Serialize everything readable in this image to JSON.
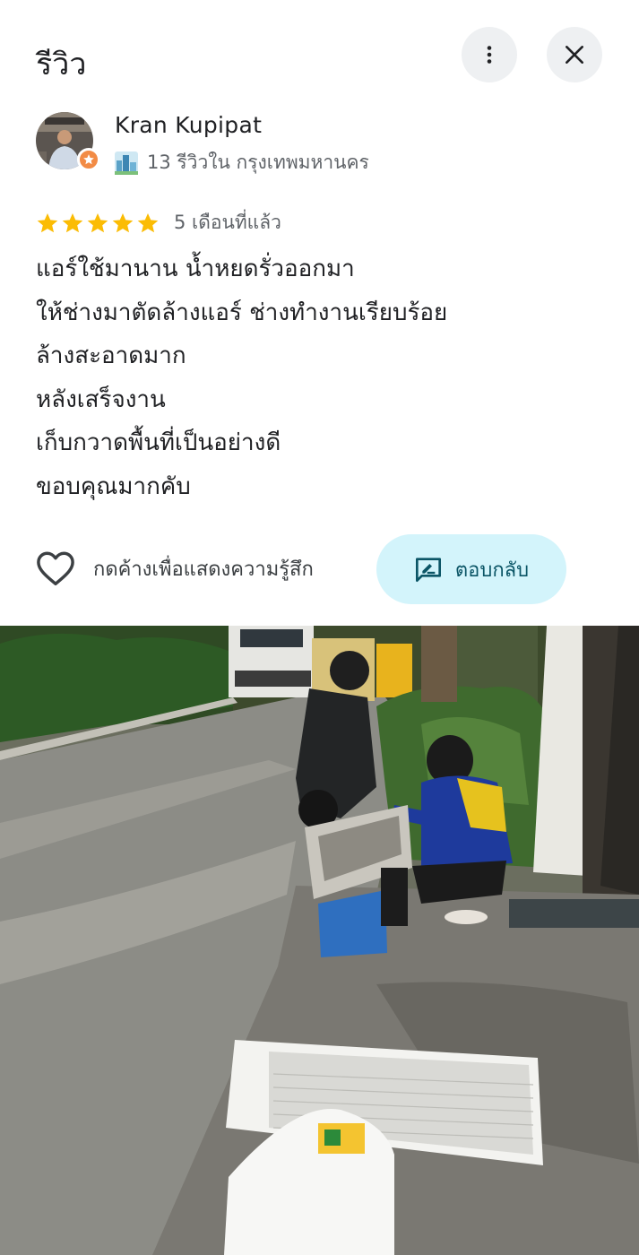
{
  "header": {
    "title": "รีวิว",
    "more_icon": "more-vert-icon",
    "close_icon": "close-icon"
  },
  "author": {
    "name": "Kran Kupipat",
    "meta": "13 รีวิวใน กรุงเทพมหานคร",
    "meta_icon": "city-icon",
    "badge_icon": "local-guide-star-icon"
  },
  "review": {
    "stars": 5,
    "max_stars": 5,
    "time_ago": "5 เดือนที่แล้ว",
    "lines": [
      "แอร์ใช้มานาน น้ำหยดรั่วออกมา",
      "ให้ช่างมาตัดล้างแอร์ ช่างทำงานเรียบร้อย",
      "ล้างสะอาดมาก",
      "หลังเสร็จงาน",
      "เก็บกวาดพื้นที่เป็นอย่างดี",
      "ขอบคุณมากคับ"
    ]
  },
  "actions": {
    "like_label": "กดค้างเพื่อแสดงความรู้สึก",
    "like_icon": "heart-outline-icon",
    "reply_label": "ตอบกลับ",
    "reply_icon": "reply-icon"
  },
  "colors": {
    "star": "#fbbc04",
    "reply_bg": "#d3f4fb",
    "reply_fg": "#0b5566",
    "badge": "#f28b45",
    "button_bg": "#eef0f2"
  }
}
